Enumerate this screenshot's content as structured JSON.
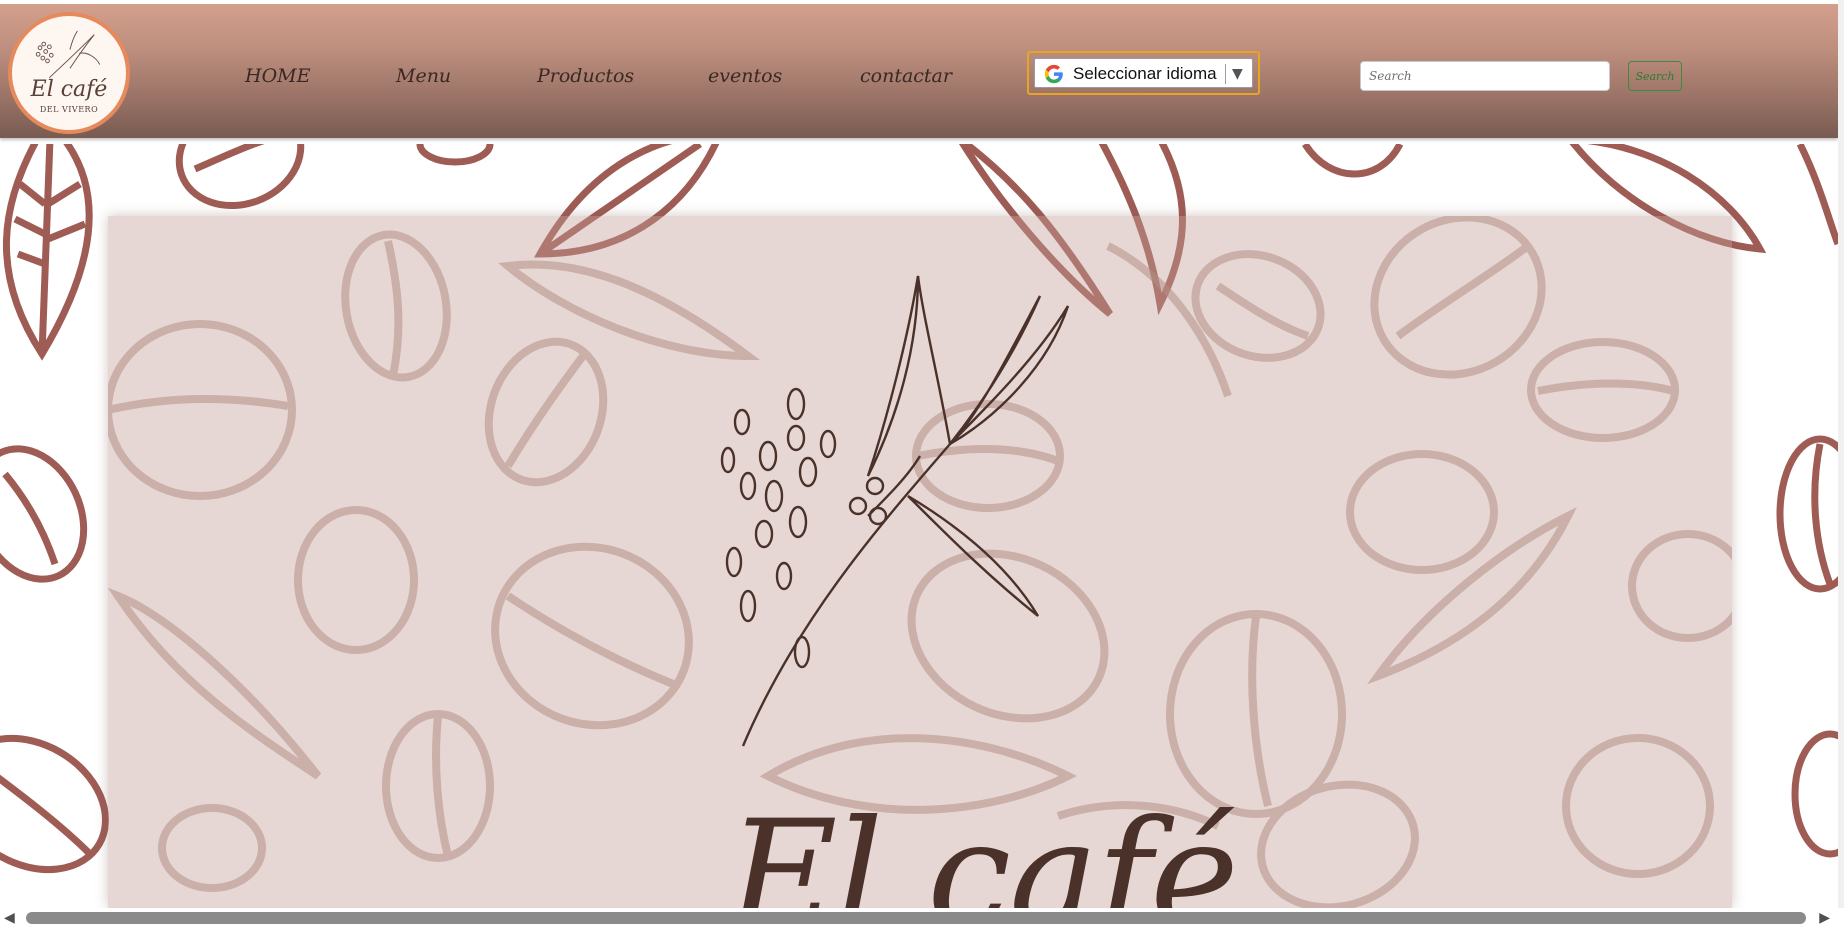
{
  "header": {
    "logo": {
      "title": "El café",
      "subtitle": "DEL VIVERO"
    },
    "nav": [
      {
        "label": "HOME"
      },
      {
        "label": "Menu"
      },
      {
        "label": "Productos"
      },
      {
        "label": "eventos"
      },
      {
        "label": "contactar"
      }
    ],
    "language": {
      "label": "Seleccionar idioma",
      "icon": "google-icon",
      "arrow": "▼"
    },
    "search": {
      "placeholder": "Search",
      "button_label": "Search"
    }
  },
  "hero": {
    "title": "El café"
  },
  "scrollbar": {
    "left_arrow": "◀",
    "right_arrow": "▶"
  },
  "colors": {
    "header_top": "#d3a08c",
    "header_bottom": "#7a5c52",
    "accent_orange": "#e6895b",
    "pattern": "#9e5c55",
    "hero_overlay": "#c5a098",
    "text_dark": "#3a2823",
    "search_green": "#3f8a3f",
    "lang_border": "#e7a524"
  }
}
